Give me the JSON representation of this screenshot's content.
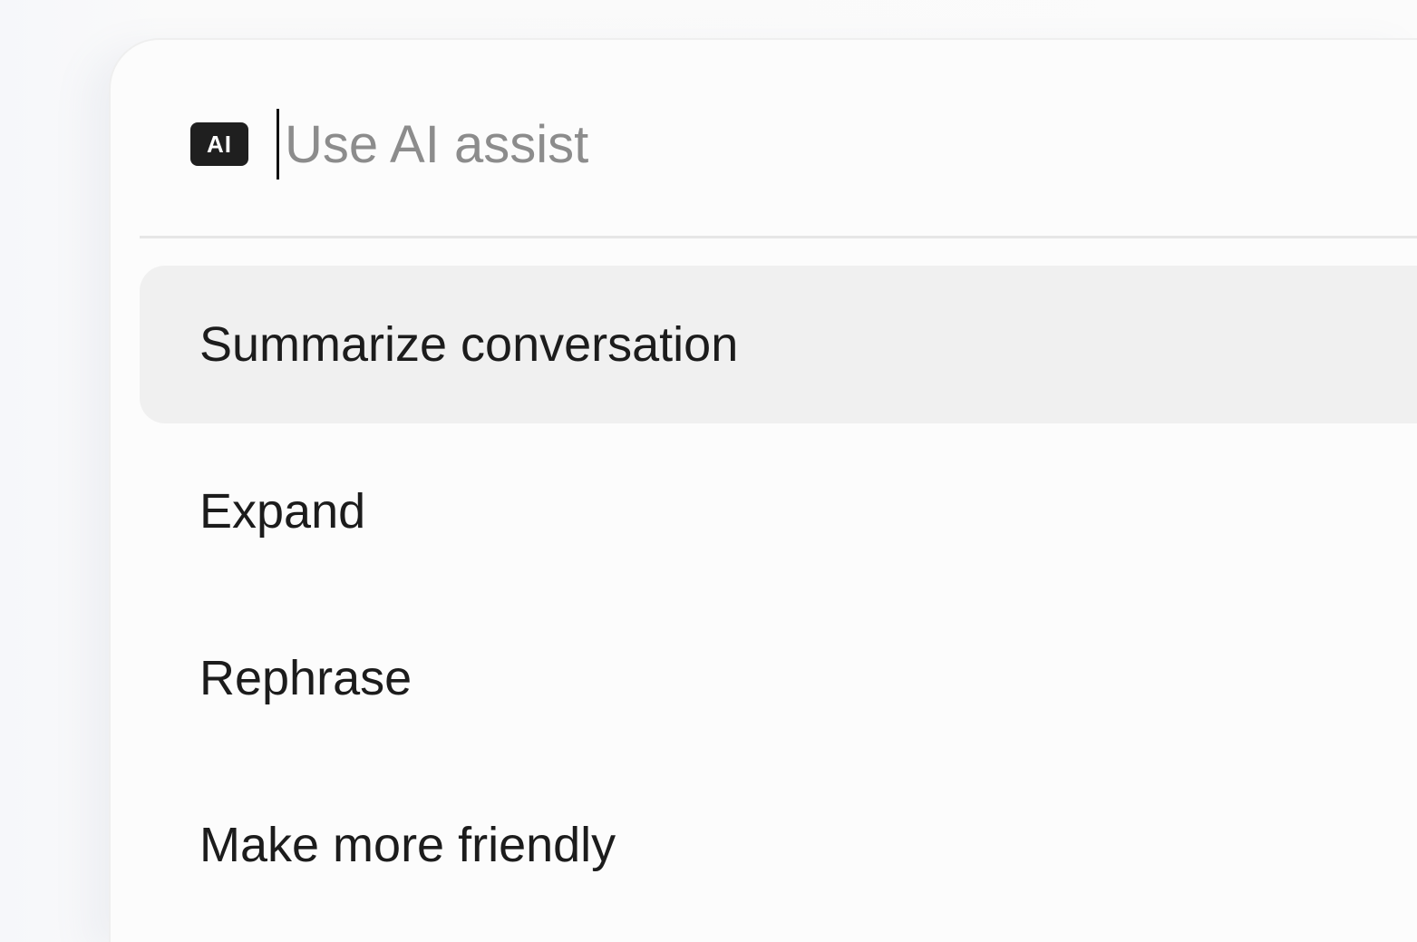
{
  "ai_assist": {
    "badge_label": "AI",
    "input_value": "",
    "input_placeholder": "Use AI assist"
  },
  "menu": {
    "items": [
      {
        "label": "Summarize conversation",
        "active": true
      },
      {
        "label": "Expand",
        "active": false
      },
      {
        "label": "Rephrase",
        "active": false
      },
      {
        "label": "Make more friendly",
        "active": false
      }
    ]
  },
  "colors": {
    "badge_bg": "#1f1f1f",
    "active_item_bg": "#f0f0f0",
    "placeholder": "#8c8c8c",
    "text": "#1c1c1c"
  }
}
